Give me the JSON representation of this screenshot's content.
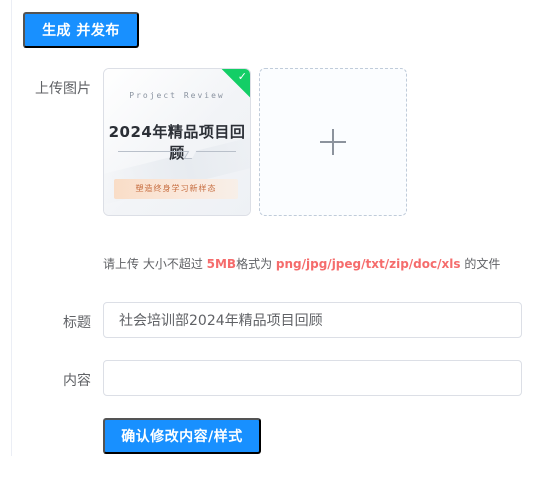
{
  "header": {
    "publish_button_label": "生成 并发布"
  },
  "upload": {
    "label": "上传图片",
    "thumbnail": {
      "subtitle": "Project Review",
      "title": "2024年精品项目回顾",
      "tagline": "塑造终身学习新样态",
      "status_icon": "check-icon"
    },
    "add_icon": "plus-icon",
    "tip": {
      "prefix": "请上传 大小不超过 ",
      "size": "5MB",
      "middle": "格式为 ",
      "formats": "png/jpg/jpeg/txt/zip/doc/xls",
      "suffix": " 的文件"
    }
  },
  "form": {
    "title_label": "标题",
    "title_value": "社会培训部2024年精品项目回顾",
    "content_label": "内容",
    "content_value": "",
    "confirm_button_label": "确认修改内容/样式"
  },
  "colors": {
    "primary": "#1890ff",
    "highlight": "#f56c6c",
    "success_badge": "#13ce66"
  }
}
